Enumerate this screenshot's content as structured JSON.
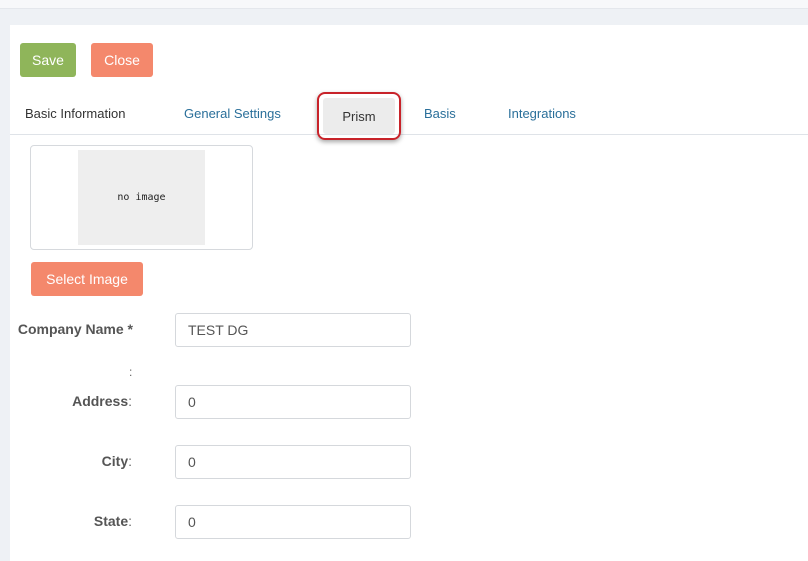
{
  "toolbar": {
    "save_label": "Save",
    "close_label": "Close"
  },
  "tabs": [
    {
      "label": "Basic Information"
    },
    {
      "label": "General Settings"
    },
    {
      "label": "Prism"
    },
    {
      "label": "Basis"
    },
    {
      "label": "Integrations"
    }
  ],
  "image": {
    "placeholder_text": "no image",
    "select_label": "Select Image"
  },
  "form": {
    "company_name": {
      "label": "Company Name *",
      "colon": ":",
      "value": "TEST DG"
    },
    "address": {
      "label": "Address",
      "colon": ":",
      "value": "0"
    },
    "city": {
      "label": "City",
      "colon": ":",
      "value": "0"
    },
    "state": {
      "label": "State",
      "colon": ":",
      "value": "0"
    }
  },
  "colors": {
    "save_button": "#8fb55a",
    "close_button": "#f4886c",
    "tab_link": "#2a6f9a",
    "highlight_outline": "#c8232a"
  }
}
